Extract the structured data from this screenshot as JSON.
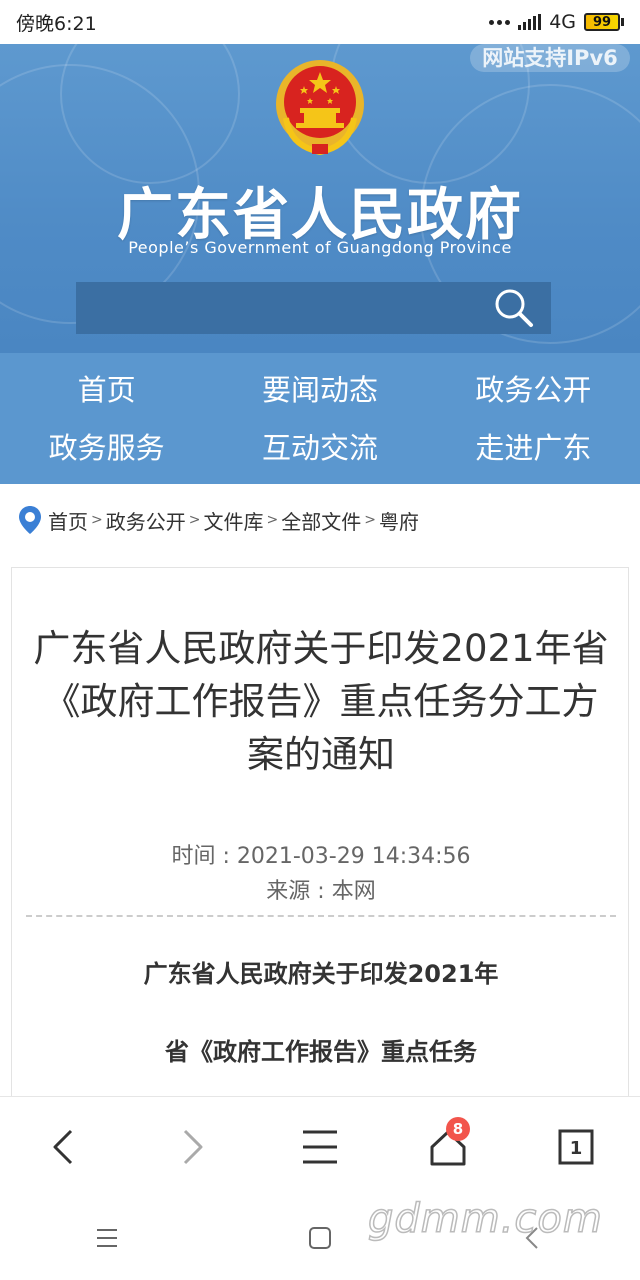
{
  "status_bar": {
    "time": "傍晚6:21",
    "network": "4G",
    "battery": "99"
  },
  "header": {
    "ipv6_badge": "网站支持IPv6",
    "title": "广东省人民政府",
    "subtitle": "People’s Government of Guangdong Province",
    "search_placeholder": ""
  },
  "nav": {
    "items": [
      "首页",
      "要闻动态",
      "政务公开",
      "政务服务",
      "互动交流",
      "走进广东"
    ]
  },
  "breadcrumb": {
    "items": [
      "首页",
      "政务公开",
      "文件库",
      "全部文件",
      "粤府"
    ]
  },
  "article": {
    "title": "广东省人民政府关于印发2021年省《政府工作报告》重点任务分工方案的通知",
    "time": "时间 : 2021-03-29 14:34:56",
    "source": "来源 : 本网",
    "body_heading_1": "广东省人民政府关于印发2021年",
    "body_heading_2": "省《政府工作报告》重点任务"
  },
  "toolbar": {
    "home_badge": "8",
    "tabs_count": "1"
  },
  "watermark": "gdmm.com",
  "colors": {
    "header_blue": "#5e99cf",
    "nav_blue": "#5b97cf",
    "search_bg": "#3b6fa3",
    "badge_red": "#f2554c"
  }
}
